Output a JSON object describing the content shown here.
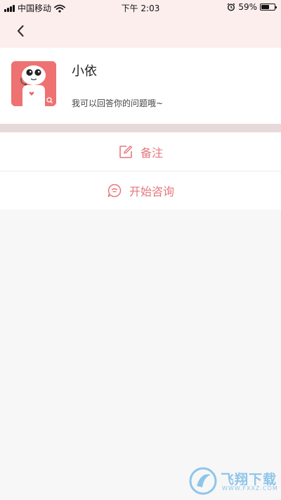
{
  "status_bar": {
    "carrier": "中国移动",
    "time": "下午 2:03",
    "battery_percent": "59%",
    "battery_level": 0.59,
    "icons": [
      "signal-icon",
      "wifi-icon",
      "alarm-icon",
      "battery-icon"
    ]
  },
  "nav": {
    "back_icon": "chevron-left-icon"
  },
  "profile": {
    "name": "小依",
    "description": "我可以回答你的问题哦~",
    "avatar_icon": "robot-avatar-icon"
  },
  "actions": [
    {
      "label": "备注",
      "icon": "edit-note-icon"
    },
    {
      "label": "开始咨询",
      "icon": "chat-bubble-icon"
    }
  ],
  "watermark": {
    "text": "飞翔下载",
    "url": "WWW.FXXZ.COM"
  },
  "colors": {
    "header_bg": "#fdeeee",
    "accent": "#e5777d",
    "avatar_bg": "#ee7272",
    "band": "#e7dada",
    "page_bg": "#f7f7f7"
  }
}
